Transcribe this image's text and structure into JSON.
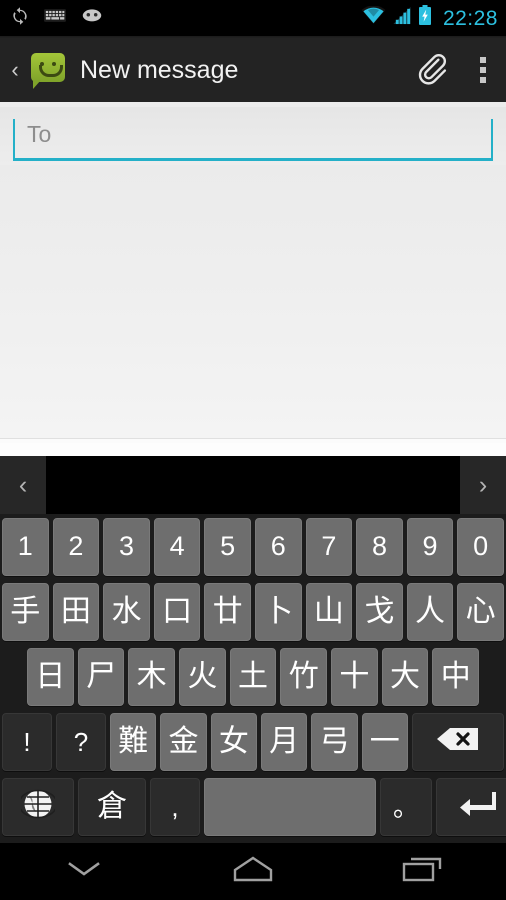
{
  "status_bar": {
    "left_icons": [
      {
        "name": "sync-icon",
        "label": "sync"
      },
      {
        "name": "keyboard-icon",
        "label": "keyboard"
      },
      {
        "name": "android-face-icon",
        "label": "android"
      }
    ],
    "right_icons": [
      {
        "name": "wifi-icon",
        "label": "wifi"
      },
      {
        "name": "signal-icon",
        "label": "signal"
      },
      {
        "name": "battery-charging-icon",
        "label": "battery charging"
      }
    ],
    "time": "22:28",
    "accent_color": "#2cc0e0"
  },
  "action_bar": {
    "back_chevron": "‹",
    "app_icon": "messaging-app-icon",
    "app_icon_color": "#a4c639",
    "title": "New message",
    "attach_label": "attach",
    "overflow_label": "more options"
  },
  "compose": {
    "to_placeholder": "To",
    "to_value": "",
    "underline_color": "#24b0c8",
    "body_value": ""
  },
  "keyboard": {
    "candidate_bar": {
      "prev_arrow": "‹",
      "next_arrow": "›",
      "candidates": ""
    },
    "rows": [
      {
        "id": "number-row",
        "keys": [
          {
            "label": "1",
            "style": "light",
            "type": "num"
          },
          {
            "label": "2",
            "style": "light",
            "type": "num"
          },
          {
            "label": "3",
            "style": "light",
            "type": "num"
          },
          {
            "label": "4",
            "style": "light",
            "type": "num"
          },
          {
            "label": "5",
            "style": "light",
            "type": "num"
          },
          {
            "label": "6",
            "style": "light",
            "type": "num"
          },
          {
            "label": "7",
            "style": "light",
            "type": "num"
          },
          {
            "label": "8",
            "style": "light",
            "type": "num"
          },
          {
            "label": "9",
            "style": "light",
            "type": "num"
          },
          {
            "label": "0",
            "style": "light",
            "type": "num"
          }
        ]
      },
      {
        "id": "cangjie-row-1",
        "keys": [
          {
            "label": "手",
            "style": "light",
            "type": "cjk"
          },
          {
            "label": "田",
            "style": "light",
            "type": "cjk"
          },
          {
            "label": "水",
            "style": "light",
            "type": "cjk"
          },
          {
            "label": "口",
            "style": "light",
            "type": "cjk"
          },
          {
            "label": "廿",
            "style": "light",
            "type": "cjk"
          },
          {
            "label": "卜",
            "style": "light",
            "type": "cjk"
          },
          {
            "label": "山",
            "style": "light",
            "type": "cjk"
          },
          {
            "label": "戈",
            "style": "light",
            "type": "cjk"
          },
          {
            "label": "人",
            "style": "light",
            "type": "cjk"
          },
          {
            "label": "心",
            "style": "light",
            "type": "cjk"
          }
        ]
      },
      {
        "id": "cangjie-row-2",
        "keys": [
          {
            "label": "日",
            "style": "light",
            "type": "cjk"
          },
          {
            "label": "尸",
            "style": "light",
            "type": "cjk"
          },
          {
            "label": "木",
            "style": "light",
            "type": "cjk"
          },
          {
            "label": "火",
            "style": "light",
            "type": "cjk"
          },
          {
            "label": "土",
            "style": "light",
            "type": "cjk"
          },
          {
            "label": "竹",
            "style": "light",
            "type": "cjk"
          },
          {
            "label": "十",
            "style": "light",
            "type": "cjk"
          },
          {
            "label": "大",
            "style": "light",
            "type": "cjk"
          },
          {
            "label": "中",
            "style": "light",
            "type": "cjk"
          }
        ]
      },
      {
        "id": "cangjie-row-3",
        "keys": [
          {
            "label": "!",
            "style": "dark",
            "type": "punc",
            "size": "punc-narrow"
          },
          {
            "label": "?",
            "style": "dark",
            "type": "punc",
            "size": "punc-narrow"
          },
          {
            "label": "難",
            "style": "light",
            "type": "cjk"
          },
          {
            "label": "金",
            "style": "light",
            "type": "cjk"
          },
          {
            "label": "女",
            "style": "light",
            "type": "cjk"
          },
          {
            "label": "月",
            "style": "light",
            "type": "cjk"
          },
          {
            "label": "弓",
            "style": "light",
            "type": "cjk"
          },
          {
            "label": "一",
            "style": "light",
            "type": "cjk"
          },
          {
            "label": "",
            "style": "dark",
            "type": "icon",
            "icon": "backspace-icon",
            "size": "bksp"
          }
        ]
      },
      {
        "id": "bottom-row",
        "keys": [
          {
            "label": "",
            "style": "dark",
            "type": "icon",
            "icon": "globe-icon",
            "size": "globe"
          },
          {
            "label": "倉",
            "style": "dark",
            "type": "cjk",
            "size": "cjmode"
          },
          {
            "label": ",",
            "style": "dark",
            "type": "punc",
            "size": "comma"
          },
          {
            "label": "",
            "style": "light",
            "type": "space",
            "icon": "space-key",
            "size": "space"
          },
          {
            "label": "。",
            "style": "dark",
            "type": "punc",
            "size": "period"
          },
          {
            "label": "",
            "style": "dark",
            "type": "icon",
            "icon": "enter-icon",
            "size": "enter"
          }
        ]
      }
    ]
  },
  "nav_bar": {
    "buttons": [
      {
        "name": "hide-keyboard-button",
        "icon": "chevron-down-icon"
      },
      {
        "name": "home-button",
        "icon": "home-icon"
      },
      {
        "name": "recents-button",
        "icon": "recents-icon"
      }
    ]
  }
}
